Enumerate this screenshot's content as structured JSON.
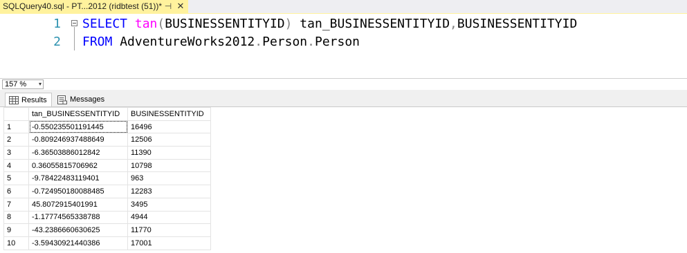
{
  "tab": {
    "title": "SQLQuery40.sql - PT...2012 (ridbtest (51))*",
    "pin_glyph": "⊣",
    "close_glyph": "✕"
  },
  "editor": {
    "lines": [
      {
        "number": "1",
        "tokens": [
          {
            "text": "SELECT",
            "kind": "kw"
          },
          {
            "text": " ",
            "kind": "plain"
          },
          {
            "text": "tan",
            "kind": "fn"
          },
          {
            "text": "(",
            "kind": "pn"
          },
          {
            "text": "BUSINESSENTITYID",
            "kind": "plain"
          },
          {
            "text": ")",
            "kind": "pn"
          },
          {
            "text": " tan_BUSINESSENTITYID",
            "kind": "plain"
          },
          {
            "text": ",",
            "kind": "pn"
          },
          {
            "text": "BUSINESSENTITYID",
            "kind": "plain"
          }
        ]
      },
      {
        "number": "2",
        "tokens": [
          {
            "text": "FROM",
            "kind": "kw"
          },
          {
            "text": " AdventureWorks2012",
            "kind": "plain"
          },
          {
            "text": ".",
            "kind": "pn"
          },
          {
            "text": "Person",
            "kind": "plain"
          },
          {
            "text": ".",
            "kind": "pn"
          },
          {
            "text": "Person",
            "kind": "plain"
          }
        ]
      }
    ]
  },
  "zoom": {
    "value": "157 %",
    "arrow": "▾"
  },
  "result_tabs": [
    {
      "label": "Results",
      "icon": "grid-icon",
      "active": true
    },
    {
      "label": "Messages",
      "icon": "messages-icon",
      "active": false
    }
  ],
  "grid": {
    "columns": [
      "tan_BUSINESSENTITYID",
      "BUSINESSENTITYID"
    ],
    "rows": [
      {
        "n": "1",
        "c1": "-0.550235501191445",
        "c2": "16496"
      },
      {
        "n": "2",
        "c1": "-0.809246937488649",
        "c2": "12506"
      },
      {
        "n": "3",
        "c1": "-6.36503886012842",
        "c2": "11390"
      },
      {
        "n": "4",
        "c1": "0.36055815706962",
        "c2": "10798"
      },
      {
        "n": "5",
        "c1": "-9.78422483119401",
        "c2": "963"
      },
      {
        "n": "6",
        "c1": "-0.724950180088485",
        "c2": "12283"
      },
      {
        "n": "7",
        "c1": "45.8072915401991",
        "c2": "3495"
      },
      {
        "n": "8",
        "c1": "-1.17774565338788",
        "c2": "4944"
      },
      {
        "n": "9",
        "c1": "-43.2386660630625",
        "c2": "11770"
      },
      {
        "n": "10",
        "c1": "-3.59430921440386",
        "c2": "17001"
      }
    ]
  },
  "colors": {
    "tab_active": "#fff29d",
    "keyword": "#0000ff",
    "function": "#ff00ff",
    "punctuation": "#808080",
    "line_number": "#2b91af"
  }
}
